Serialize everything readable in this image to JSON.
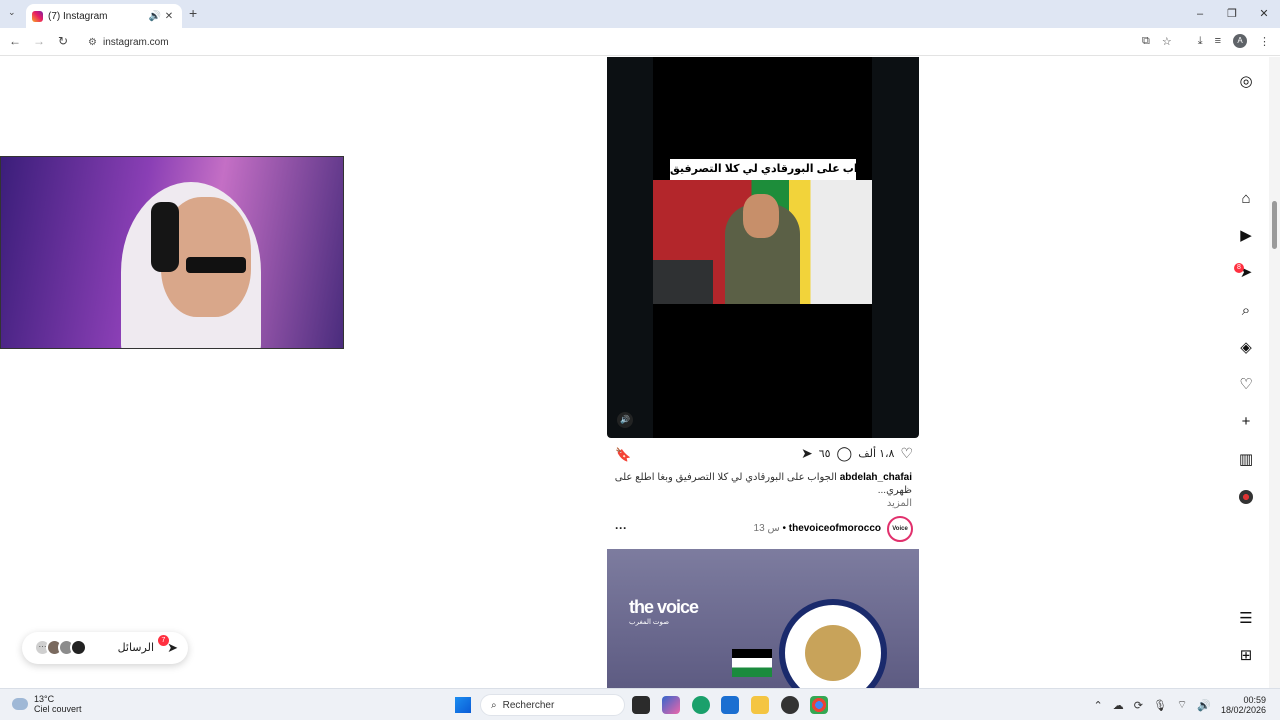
{
  "browser": {
    "tab_title": "(7) Instagram",
    "tab_audio_icon": "🔊",
    "tab_close": "✕",
    "new_tab": "+",
    "tab_list": "⌄",
    "url": "instagram.com",
    "window": {
      "minimize": "–",
      "maximize": "❐",
      "close": "✕"
    },
    "profile_initial": "A"
  },
  "post1": {
    "video_caption": "الجواب على البورقادي لي كلا التصرفيق",
    "likes": "١،٨ ألف",
    "comments": "٦٥",
    "username": "abdelah_chafai",
    "caption_text": "الجواب على البورقادي لي كلا التصرفيق وبغا اطلع على ظهري...",
    "more": "المزيد"
  },
  "post2": {
    "username": "thevoiceofmorocco",
    "time": "13 س",
    "separator": "•",
    "avatar_text": "Voice",
    "options": "···",
    "brand": "the voice",
    "brand_sub": "صوت المغرب"
  },
  "messages": {
    "label": "الرسائل",
    "badge": "7",
    "overflow": "···"
  },
  "sidenav": {
    "notif_badge": "8"
  },
  "taskbar": {
    "temperature": "13°C",
    "weather": "Ciel couvert",
    "search_placeholder": "Rechercher",
    "time": "00:59",
    "date": "18/02/2026"
  },
  "colors": {
    "badge_red": "#ff3040",
    "tabbar_bg": "#dfe6f3",
    "story_ring": "#e1306c"
  }
}
